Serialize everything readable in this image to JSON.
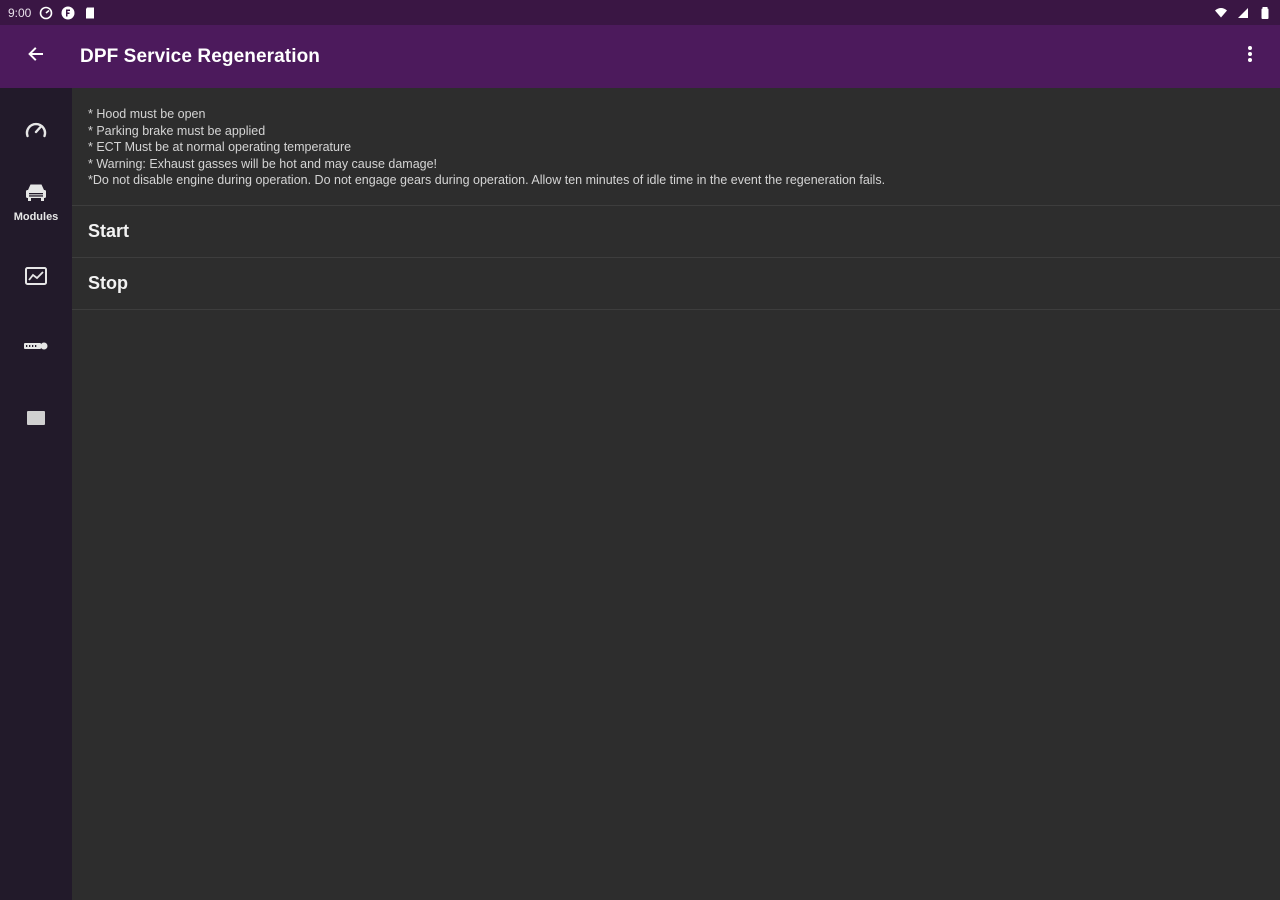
{
  "status_bar": {
    "time": "9:00"
  },
  "app_bar": {
    "title": "DPF Service Regeneration"
  },
  "nav_rail": {
    "items": [
      {
        "icon": "gauge-icon",
        "label": ""
      },
      {
        "icon": "car-icon",
        "label": "Modules"
      },
      {
        "icon": "chart-icon",
        "label": ""
      },
      {
        "icon": "obd-icon",
        "label": ""
      },
      {
        "icon": "square-icon",
        "label": ""
      }
    ]
  },
  "notes": [
    "* Hood must be open",
    "* Parking brake must be applied",
    "* ECT Must be at normal operating temperature",
    "* Warning: Exhaust gasses will be hot and may cause damage!",
    "*Do not disable engine during operation. Do not engage gears during operation. Allow ten minutes of idle time in the event the regeneration fails."
  ],
  "actions": [
    {
      "label": "Start"
    },
    {
      "label": "Stop"
    }
  ],
  "colors": {
    "status_bar": "#3a1644",
    "app_bar": "#4c1a5c",
    "nav_rail": "#221a2a",
    "content": "#2d2d2d"
  }
}
